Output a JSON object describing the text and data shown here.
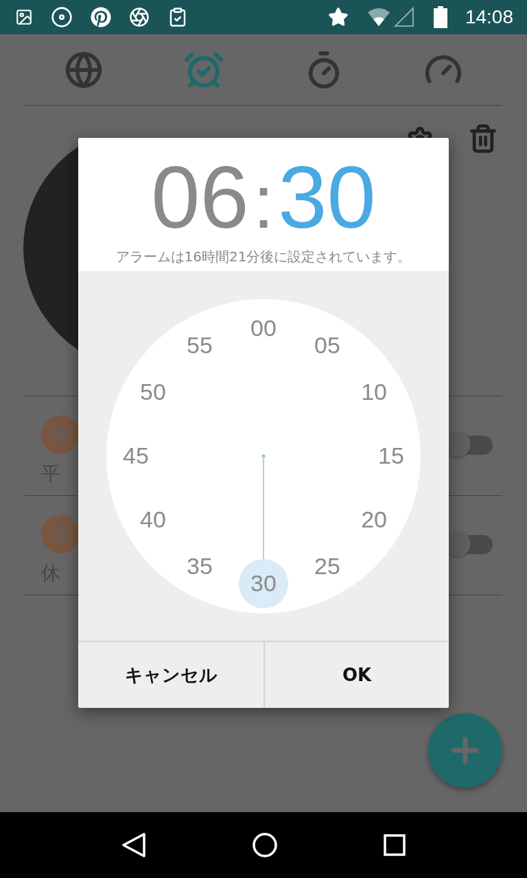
{
  "status_bar": {
    "time": "14:08"
  },
  "tabs": [
    {
      "kind": "world",
      "selected": false
    },
    {
      "kind": "alarm",
      "selected": true
    },
    {
      "kind": "stopwatch",
      "selected": false
    },
    {
      "kind": "timer",
      "selected": false
    }
  ],
  "alarms": [
    {
      "label": "平",
      "on": false
    },
    {
      "label": "休",
      "on": false
    }
  ],
  "dialog": {
    "time": [
      {
        "text": "06",
        "selected": false
      },
      {
        "text": "30",
        "selected": true
      }
    ],
    "separator": ":",
    "message": "アラームは16時間21分後に設定されています。",
    "dial": [
      {
        "label": "00",
        "selected": false
      },
      {
        "label": "05",
        "selected": false
      },
      {
        "label": "10",
        "selected": false
      },
      {
        "label": "15",
        "selected": false
      },
      {
        "label": "20",
        "selected": false
      },
      {
        "label": "25",
        "selected": false
      },
      {
        "label": "30",
        "selected": true
      },
      {
        "label": "35",
        "selected": false
      },
      {
        "label": "40",
        "selected": false
      },
      {
        "label": "45",
        "selected": false
      },
      {
        "label": "50",
        "selected": false
      },
      {
        "label": "55",
        "selected": false
      }
    ],
    "buttons": [
      {
        "label": "キャンセル"
      },
      {
        "label": "OK"
      }
    ]
  }
}
